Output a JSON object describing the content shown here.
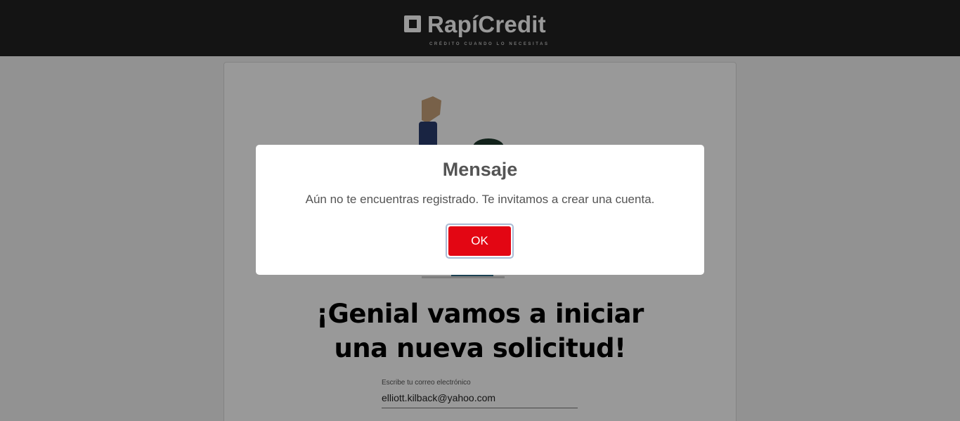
{
  "header": {
    "brand": "RapíCredit",
    "tagline": "CRÉDITO CUANDO LO NECESITAS",
    "background_color": "#222222"
  },
  "main": {
    "heading_line1": "¡Genial vamos a iniciar",
    "heading_line2": "una nueva solicitud!",
    "email_field": {
      "label": "Escribe tu correo electrónico",
      "value": "elliott.kilback@yahoo.com"
    }
  },
  "modal": {
    "title": "Mensaje",
    "message": "Aún no te encuentras registrado. Te invitamos a crear una cuenta.",
    "ok_label": "OK",
    "ok_color": "#e30613"
  }
}
